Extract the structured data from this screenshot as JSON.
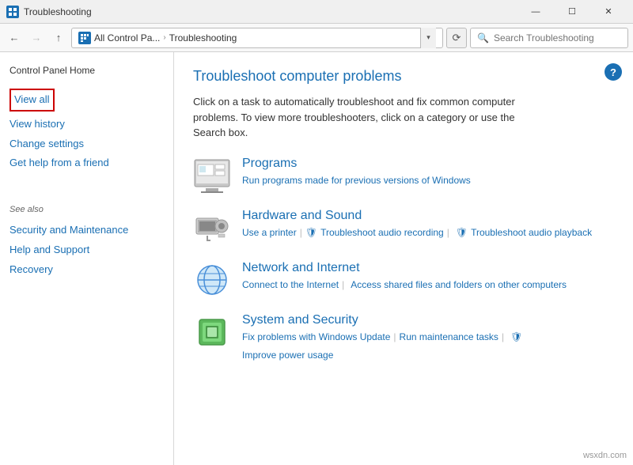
{
  "titleBar": {
    "title": "Troubleshooting",
    "minimizeLabel": "—",
    "maximizeLabel": "☐",
    "closeLabel": "✕"
  },
  "addressBar": {
    "backLabel": "←",
    "forwardLabel": "→",
    "upLabel": "↑",
    "addressShort": "All Control Pa...",
    "addressFull": "Troubleshooting",
    "refreshLabel": "⟳",
    "searchPlaceholder": "Search Troubleshooting"
  },
  "sidebar": {
    "home": "Control Panel Home",
    "links": [
      {
        "label": "View all",
        "highlighted": true
      },
      {
        "label": "View history",
        "highlighted": false
      },
      {
        "label": "Change settings",
        "highlighted": false
      },
      {
        "label": "Get help from a friend",
        "highlighted": false
      }
    ],
    "seeAlso": "See also",
    "seeAlsoLinks": [
      "Security and Maintenance",
      "Help and Support",
      "Recovery"
    ]
  },
  "content": {
    "title": "Troubleshoot computer problems",
    "description": "Click on a task to automatically troubleshoot and fix common computer problems. To view more troubleshooters, click on a category or use the Search box.",
    "helpLabel": "?",
    "categories": [
      {
        "name": "Programs",
        "links": [
          {
            "text": "Run programs made for previous versions of Windows",
            "isLink": true,
            "hasShield": false
          }
        ]
      },
      {
        "name": "Hardware and Sound",
        "links": [
          {
            "text": "Use a printer",
            "isLink": true,
            "hasShield": false
          },
          {
            "separator": true
          },
          {
            "text": "Troubleshoot audio recording",
            "isLink": true,
            "hasShield": true
          },
          {
            "separator": true
          },
          {
            "text": "Troubleshoot audio playback",
            "isLink": true,
            "hasShield": true,
            "newline": true
          }
        ]
      },
      {
        "name": "Network and Internet",
        "links": [
          {
            "text": "Connect to the Internet",
            "isLink": true,
            "hasShield": false
          },
          {
            "separator": true
          },
          {
            "text": "Access shared files and folders on other computers",
            "isLink": true,
            "hasShield": false,
            "newline": true
          }
        ]
      },
      {
        "name": "System and Security",
        "links": [
          {
            "text": "Fix problems with Windows Update",
            "isLink": true,
            "hasShield": false
          },
          {
            "separator": true
          },
          {
            "text": "Run maintenance tasks",
            "isLink": true,
            "hasShield": false
          },
          {
            "separator": true
          },
          {
            "text": "Improve power usage",
            "isLink": true,
            "hasShield": true,
            "newline": true
          }
        ]
      }
    ]
  },
  "watermark": "wsxdn.com"
}
